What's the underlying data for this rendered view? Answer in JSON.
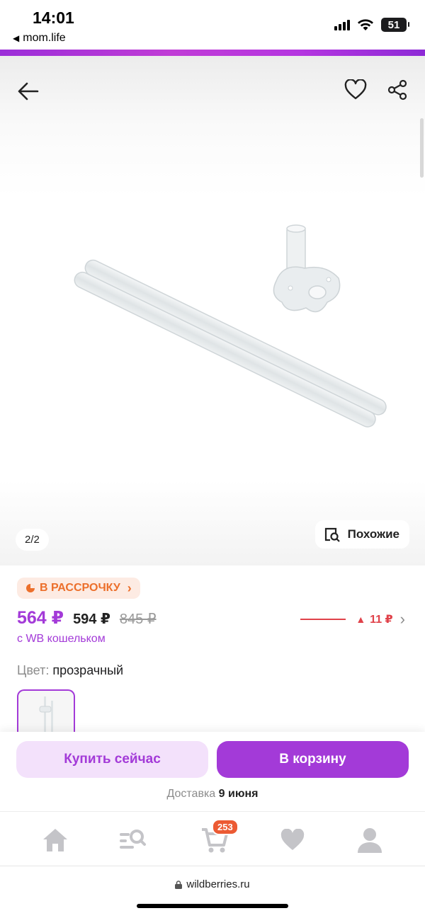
{
  "status_bar": {
    "time": "14:01",
    "back_app": "mom.life",
    "battery": "51"
  },
  "gallery": {
    "counter": "2/2",
    "similar_label": "Похожие"
  },
  "product": {
    "installment_label": "В РАССРОЧКУ",
    "price_main": "564 ₽",
    "price_wallet": "594 ₽",
    "price_old": "845 ₽",
    "wallet_note": "с WB кошельком",
    "price_trend": "11 ₽",
    "color_label": "Цвет:",
    "color_value": "прозрачный"
  },
  "actions": {
    "buy_now": "Купить сейчас",
    "add_to_cart": "В корзину",
    "delivery_label": "Доставка",
    "delivery_date": "9 июня"
  },
  "nav": {
    "cart_count": "253",
    "items": [
      "home-icon",
      "catalog-search-icon",
      "cart-icon",
      "heart-icon",
      "profile-icon"
    ]
  },
  "browser": {
    "url": "wildberries.ru"
  },
  "colors": {
    "brand": "#a33ad8",
    "accent_orange": "#ec6f2b",
    "trend_red": "#e0424a"
  }
}
